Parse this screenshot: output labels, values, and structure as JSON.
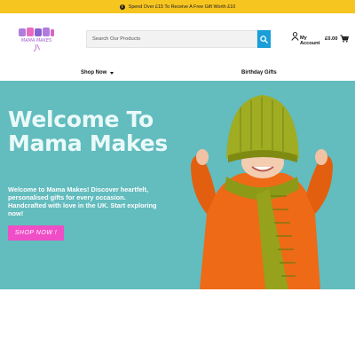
{
  "promo": {
    "text": "Spend Over £15 To Receive A Free Gift Worth £10",
    "icon": "info-icon"
  },
  "header": {
    "logo_text": "Mama Makes",
    "search": {
      "placeholder": "Search Our Products",
      "button_icon": "search-icon"
    },
    "account": {
      "line1": "My",
      "line2": "Account",
      "icon": "user-icon"
    },
    "cart": {
      "amount": "£0.00",
      "icon": "cart-icon"
    }
  },
  "nav": {
    "shop_now": "Shop Now",
    "birthday_gifts": "Birthday Gifts"
  },
  "hero": {
    "title_line1": "Welcome To",
    "title_line2": "Mama Makes",
    "text": "Welcome to Mama Makes! Discover heartfelt, personalised gifts for every occasion. Handcrafted with love in the UK. Start exploring now!",
    "button": "SHOP NOW !"
  },
  "colors": {
    "promo_bg": "#f6c520",
    "accent_blue": "#1a9fd8",
    "hero_bg": "#63bcbe",
    "cta_pink": "#ef4ec7"
  }
}
